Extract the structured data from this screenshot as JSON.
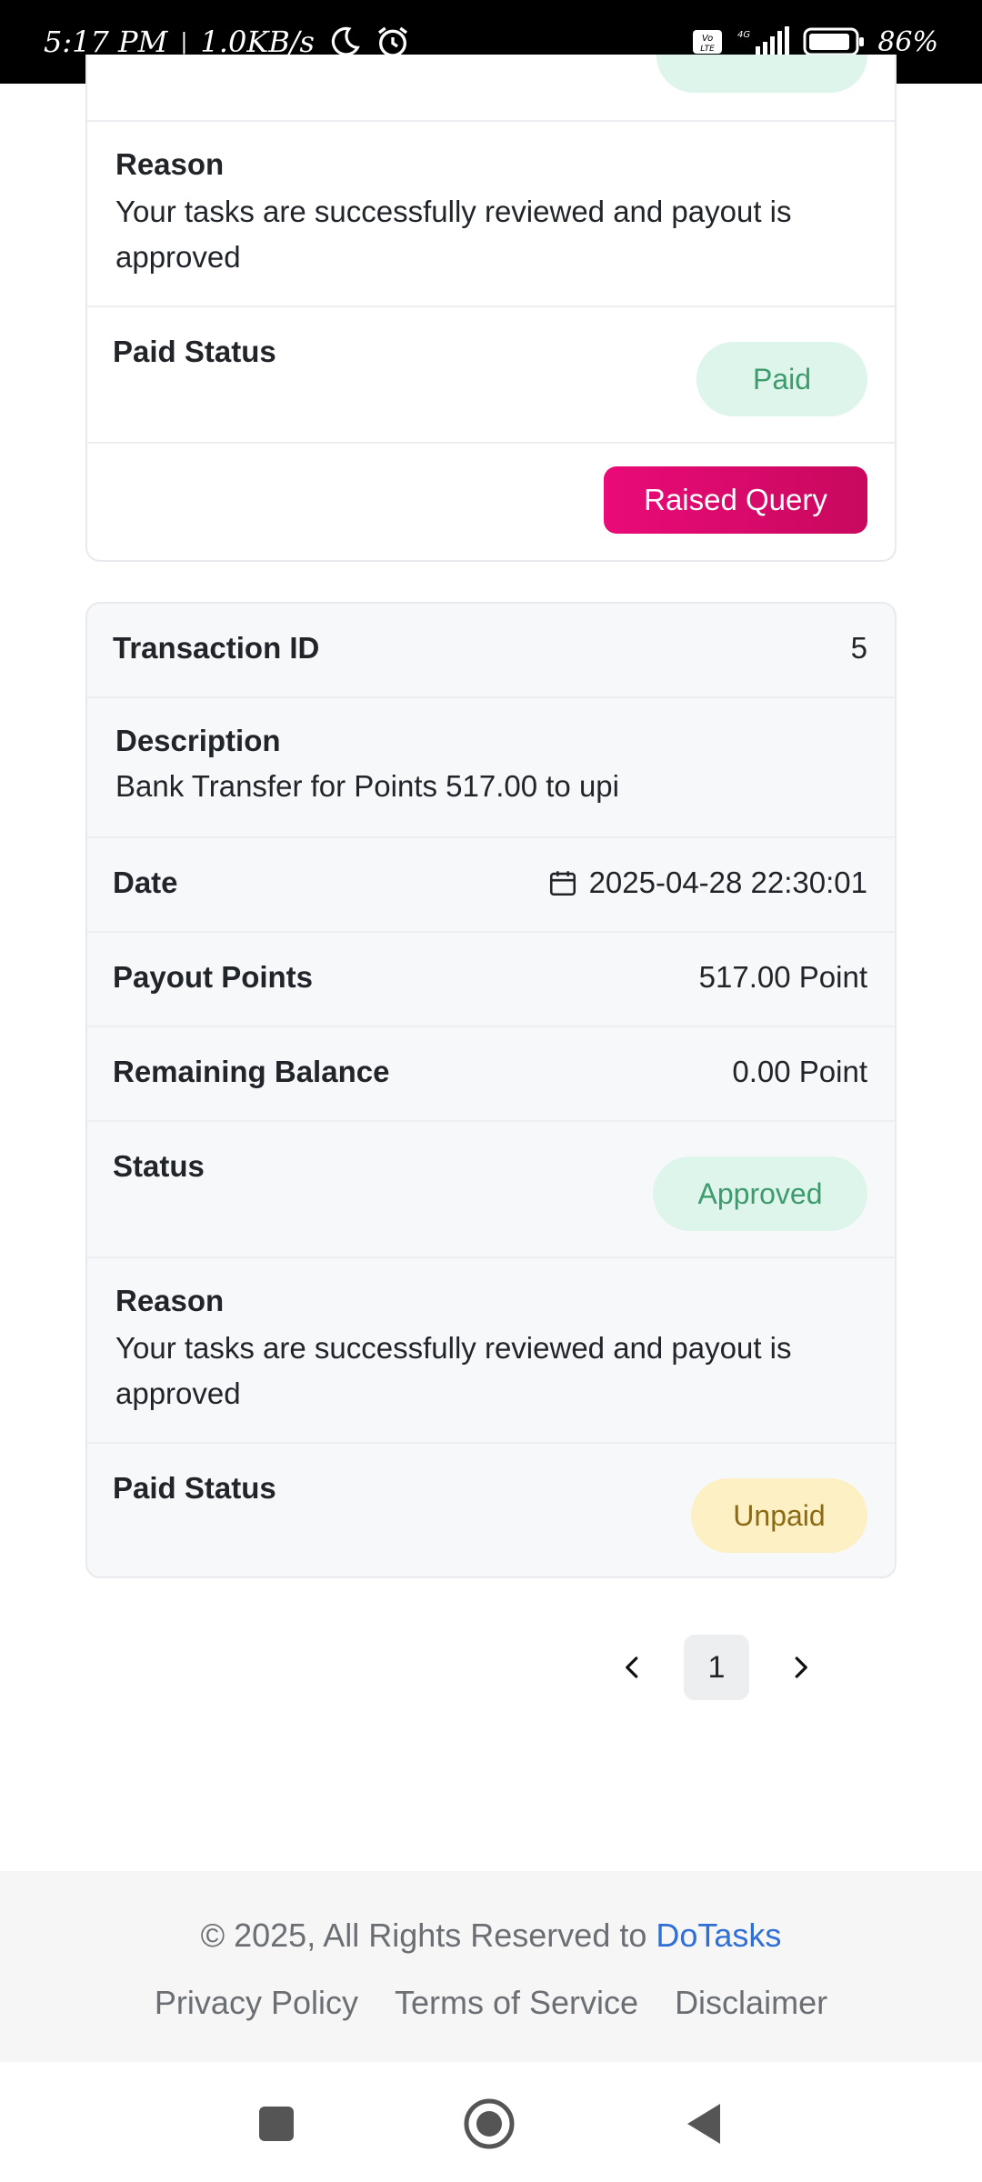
{
  "status_bar": {
    "time": "5:17 PM",
    "speed": "1.0KB/s",
    "battery": "86%"
  },
  "card1": {
    "reason_label": "Reason",
    "reason_text": "Your tasks are successfully reviewed and payout is approved",
    "paid_status_label": "Paid Status",
    "paid_status_value": "Paid",
    "raise_query_label": "Raised Query"
  },
  "card2": {
    "transaction_id_label": "Transaction ID",
    "transaction_id_value": "5",
    "description_label": "Description",
    "description_text": "Bank Transfer for Points 517.00 to upi",
    "date_label": "Date",
    "date_value": "2025-04-28 22:30:01",
    "payout_label": "Payout Points",
    "payout_value": "517.00 Point",
    "remaining_label": "Remaining Balance",
    "remaining_value": "0.00 Point",
    "status_label": "Status",
    "status_value": "Approved",
    "reason_label": "Reason",
    "reason_text": "Your tasks are successfully reviewed and payout is approved",
    "paid_status_label": "Paid Status",
    "paid_status_value": "Unpaid"
  },
  "pagination": {
    "current_page": "1"
  },
  "footer": {
    "copyright": "© 2025, All Rights Reserved to",
    "brand": "DoTasks",
    "links": [
      "Privacy Policy",
      "Terms of Service",
      "Disclaimer"
    ]
  },
  "colors": {
    "accent_pink": "#e2096f",
    "success": "#3e9b6e",
    "warning": "#8a6a12",
    "link": "#2f6fd6"
  }
}
